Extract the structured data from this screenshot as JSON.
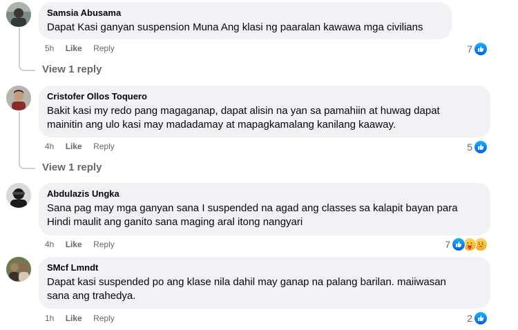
{
  "comments": [
    {
      "author": "Samsia Abusama",
      "lines": [
        "Dapat Kasi ganyan suspension Muna Ang klasi ng paaralan kawawa mga civilians"
      ],
      "time": "5h",
      "like_label": "Like",
      "reply_label": "Reply",
      "reaction_count": "7",
      "view_replies": "View 1 reply"
    },
    {
      "author": "Cristofer Ollos Toquero",
      "lines": [
        "Bakit kasi my redo pang magaganap, dapat alisin na yan sa pamahiin at huwag dapat",
        "mainitin ang ulo kasi may madadamay at mapagkamalang kanilang kaaway."
      ],
      "time": "4h",
      "like_label": "Like",
      "reply_label": "Reply",
      "reaction_count": "5",
      "view_replies": "View 1 reply"
    },
    {
      "author": "Abdulazis Ungka",
      "lines": [
        "Sana pag may mga ganyan sana I suspended na agad ang classes sa kalapit bayan para",
        "Hindi maulit ang ganito sana maging aral itong nangyari"
      ],
      "time": "4h",
      "like_label": "Like",
      "reply_label": "Reply",
      "reaction_count": "7"
    },
    {
      "author": "SMcf Lmndt",
      "lines": [
        "Dapat kasi suspended po ang klase nila dahil may ganap na palang barilan. maiiwasan",
        "sana ang trahedya."
      ],
      "time": "1h",
      "like_label": "Like",
      "reply_label": "Reply",
      "reaction_count": "2"
    }
  ],
  "icons": {
    "like": "like-reaction-icon",
    "care": "care-reaction-icon",
    "sad": "sad-reaction-icon"
  },
  "colors": {
    "bubble": "#f0f2f5",
    "secondary_text": "#65676b",
    "like_blue": "#0866ff"
  }
}
